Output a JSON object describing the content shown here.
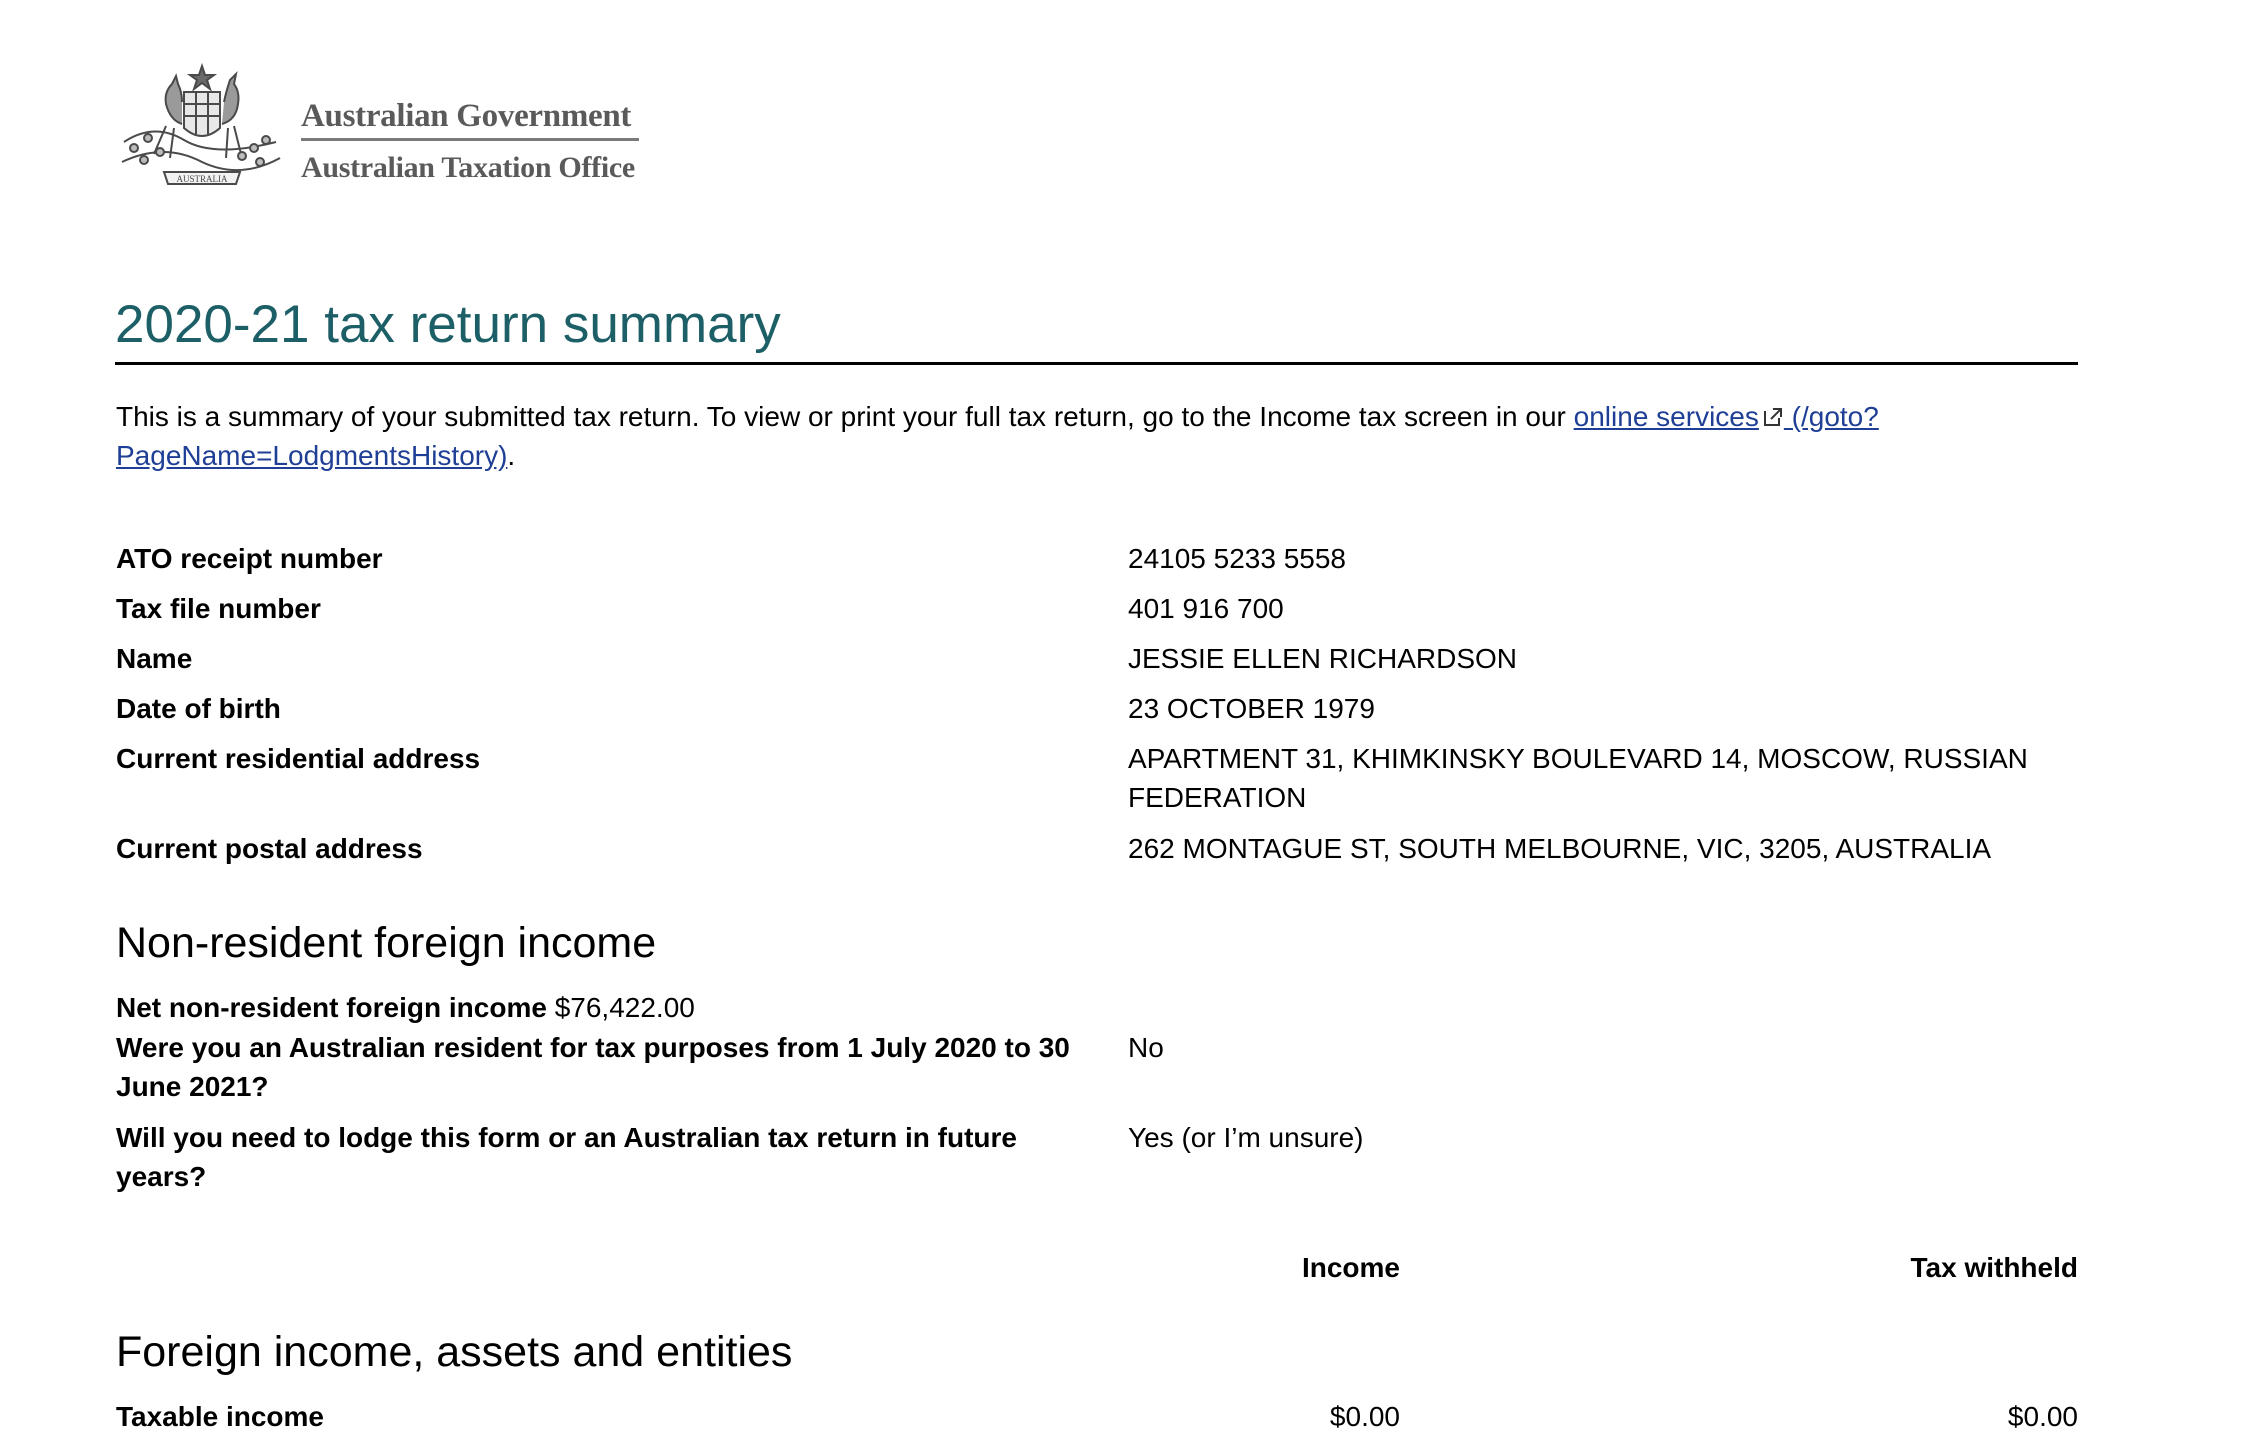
{
  "header": {
    "org_line1": "Australian Government",
    "org_line2": "Australian Taxation Office",
    "crest_text": "AUSTRALIA"
  },
  "title": "2020-21 tax return summary",
  "intro": {
    "text_before": "This is a summary of your submitted tax return. To view or print your full tax return, go to the Income tax screen in our ",
    "link_text": "online services",
    "link_path": " (/goto?PageName=LodgmentsHistory)",
    "text_after": "."
  },
  "details": [
    {
      "label": "ATO receipt number",
      "value": "24105 5233 5558"
    },
    {
      "label": "Tax file number",
      "value": "401 916 700"
    },
    {
      "label": "Name",
      "value": "JESSIE ELLEN RICHARDSON"
    },
    {
      "label": "Date of birth",
      "value": "23 OCTOBER 1979"
    },
    {
      "label": "Current residential address",
      "value": "APARTMENT 31, KHIMKINSKY BOULEVARD 14, MOSCOW, RUSSIAN FEDERATION"
    },
    {
      "label": "Current postal address",
      "value": "262 MONTAGUE ST, SOUTH MELBOURNE, VIC, 3205, AUSTRALIA"
    }
  ],
  "non_resident": {
    "heading": "Non-resident foreign income",
    "net_label": "Net non-resident foreign income",
    "net_value": "$76,422.00",
    "q1_label": "Were you an Australian resident for tax purposes from 1 July 2020 to 30 June 2021?",
    "q1_value": "No",
    "q2_label": "Will you need to lodge this form or an Australian tax return in future years?",
    "q2_value": "Yes (or I’m unsure)"
  },
  "columns": {
    "income": "Income",
    "tax_withheld": "Tax withheld"
  },
  "foreign": {
    "heading": "Foreign income, assets and entities",
    "rows": [
      {
        "label": "Taxable income",
        "income": "$0.00",
        "tax_withheld": "$0.00"
      }
    ]
  }
}
